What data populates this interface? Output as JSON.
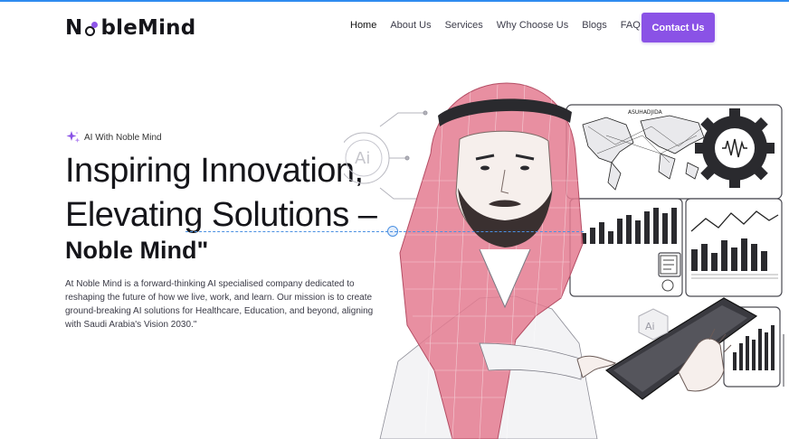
{
  "header": {
    "logo": {
      "part1": "N",
      "part2": "ble",
      "part3": "Mind"
    },
    "nav": [
      "Home",
      "About Us",
      "Services",
      "Why Choose Us",
      "Blogs",
      "FAQ"
    ],
    "contact_label": "Contact Us"
  },
  "hero": {
    "badge": "AI With Noble Mind",
    "line1": "Inspiring Innovation,",
    "line2": "Elevating Solutions –",
    "line3": "Noble Mind\"",
    "description": "At Noble Mind is a forward-thinking AI specialised company dedicated to reshaping the future of how we live, work, and learn. Our mission is to create ground-breaking AI solutions for Healthcare, Education, and beyond, aligning with Saudi Arabia's Vision 2030.\""
  },
  "illustration": {
    "ai_label": "Ai",
    "board_label": "ASUHADJIDA",
    "icons": [
      "sparkle-icon",
      "gear-icon",
      "world-map-icon",
      "tablet-icon"
    ]
  },
  "colors": {
    "accent": "#8a52e6",
    "topline": "#2f8cf0",
    "headscarf": "#e0607a",
    "text": "#15151a"
  }
}
